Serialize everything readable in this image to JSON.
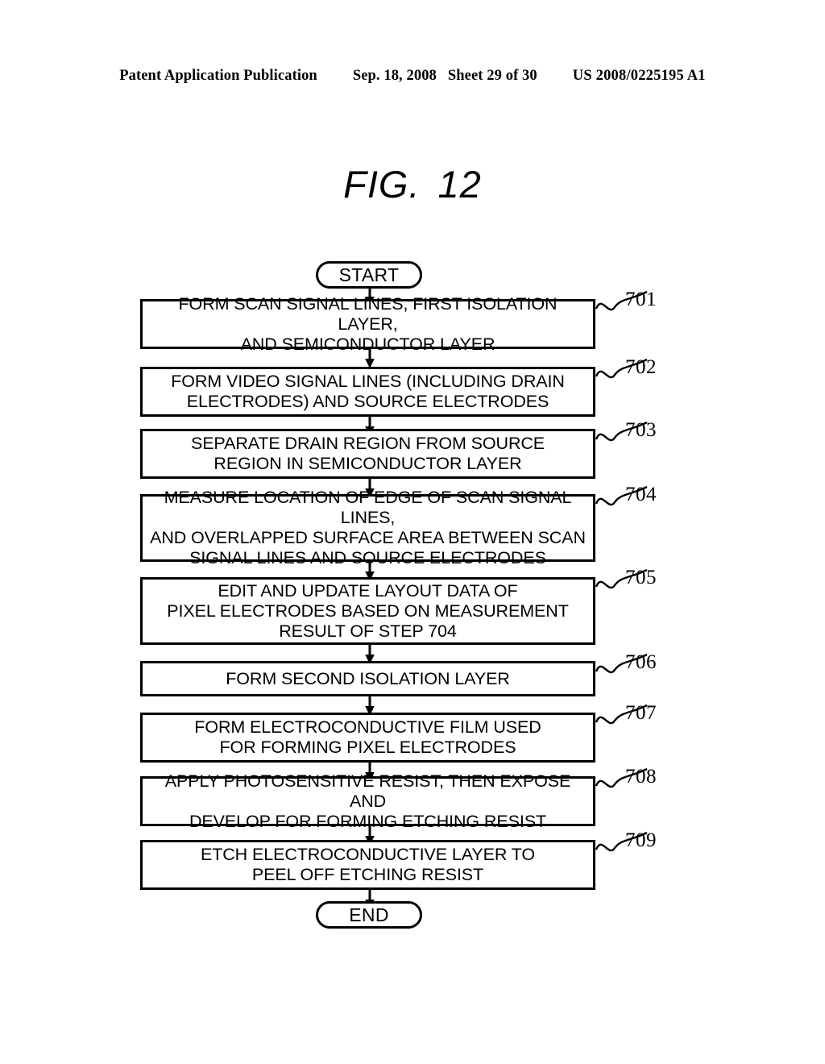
{
  "header": {
    "publication": "Patent Application Publication",
    "date": "Sep. 18, 2008",
    "sheet": "Sheet 29 of 30",
    "patent_number": "US 2008/0225195 A1"
  },
  "figure": {
    "label": "FIG.",
    "number": "12"
  },
  "flowchart": {
    "start_label": "START",
    "end_label": "END",
    "steps": [
      {
        "ref": "701",
        "text": "FORM SCAN SIGNAL LINES, FIRST ISOLATION LAYER,\nAND SEMICONDUCTOR LAYER"
      },
      {
        "ref": "702",
        "text": "FORM VIDEO SIGNAL LINES (INCLUDING DRAIN\nELECTRODES) AND SOURCE ELECTRODES"
      },
      {
        "ref": "703",
        "text": "SEPARATE DRAIN REGION FROM SOURCE\nREGION IN SEMICONDUCTOR LAYER"
      },
      {
        "ref": "704",
        "text": "MEASURE LOCATION OF EDGE OF SCAN SIGNAL LINES,\nAND OVERLAPPED SURFACE AREA BETWEEN SCAN\nSIGNAL LINES AND SOURCE ELECTRODES"
      },
      {
        "ref": "705",
        "text": "EDIT AND UPDATE LAYOUT DATA OF\nPIXEL ELECTRODES BASED ON MEASUREMENT\nRESULT OF STEP 704"
      },
      {
        "ref": "706",
        "text": "FORM SECOND ISOLATION LAYER"
      },
      {
        "ref": "707",
        "text": "FORM ELECTROCONDUCTIVE FILM USED\nFOR FORMING PIXEL ELECTRODES"
      },
      {
        "ref": "708",
        "text": "APPLY PHOTOSENSITIVE RESIST, THEN EXPOSE AND\nDEVELOP FOR FORMING ETCHING RESIST"
      },
      {
        "ref": "709",
        "text": "ETCH ELECTROCONDUCTIVE LAYER TO\nPEEL OFF ETCHING RESIST"
      }
    ]
  },
  "colors": {
    "ink": "#000000",
    "paper": "#ffffff"
  }
}
